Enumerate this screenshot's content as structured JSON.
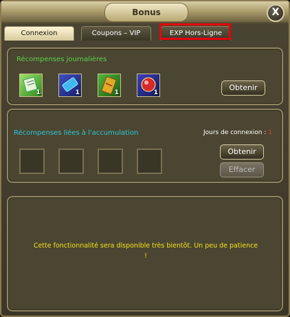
{
  "window": {
    "title": "Bonus",
    "close_label": "X"
  },
  "tabs": [
    {
      "label": "Connexion",
      "active": true
    },
    {
      "label": "Coupons – VIP",
      "active": false
    },
    {
      "label": "EXP Hors-Ligne",
      "active": false,
      "highlighted": true
    }
  ],
  "daily": {
    "title": "Récompenses journalières",
    "items": [
      {
        "icon": "scroll-icon",
        "qty": "1"
      },
      {
        "icon": "ticket-icon",
        "qty": "1"
      },
      {
        "icon": "gold-card-icon",
        "qty": "1"
      },
      {
        "icon": "red-orb-icon",
        "qty": "1"
      }
    ],
    "button": "Obtenir"
  },
  "accumulation": {
    "title": "Récompenses liées à l'accumulation",
    "days_label": "Jours de connexion :",
    "days_value": "1",
    "obtain_button": "Obtenir",
    "clear_button": "Effacer"
  },
  "notice": {
    "line1": "Cette fonctionnalité sera disponible très bientôt. Un peu de patience",
    "line2": "!"
  },
  "colors": {
    "highlight": "#e8000b",
    "green_title": "#5bd24b",
    "cyan_title": "#2bc6d6",
    "notice": "#f4e21b",
    "days_value": "#ff3333"
  }
}
